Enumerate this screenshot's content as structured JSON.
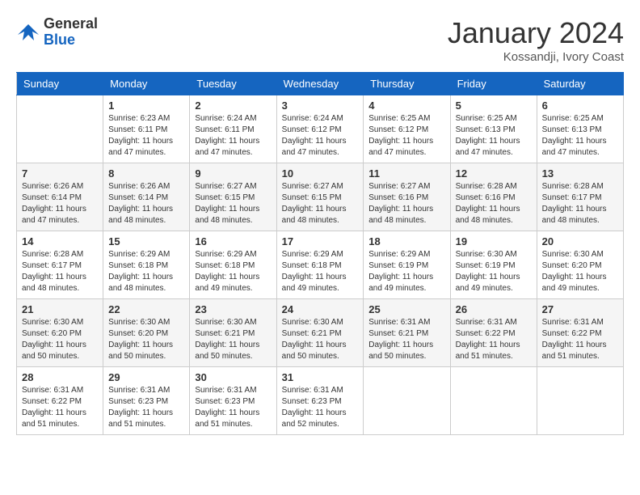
{
  "header": {
    "logo_general": "General",
    "logo_blue": "Blue",
    "title": "January 2024",
    "subtitle": "Kossandji, Ivory Coast"
  },
  "days_of_week": [
    "Sunday",
    "Monday",
    "Tuesday",
    "Wednesday",
    "Thursday",
    "Friday",
    "Saturday"
  ],
  "weeks": [
    [
      {
        "day": "",
        "info": ""
      },
      {
        "day": "1",
        "info": "Sunrise: 6:23 AM\nSunset: 6:11 PM\nDaylight: 11 hours\nand 47 minutes."
      },
      {
        "day": "2",
        "info": "Sunrise: 6:24 AM\nSunset: 6:11 PM\nDaylight: 11 hours\nand 47 minutes."
      },
      {
        "day": "3",
        "info": "Sunrise: 6:24 AM\nSunset: 6:12 PM\nDaylight: 11 hours\nand 47 minutes."
      },
      {
        "day": "4",
        "info": "Sunrise: 6:25 AM\nSunset: 6:12 PM\nDaylight: 11 hours\nand 47 minutes."
      },
      {
        "day": "5",
        "info": "Sunrise: 6:25 AM\nSunset: 6:13 PM\nDaylight: 11 hours\nand 47 minutes."
      },
      {
        "day": "6",
        "info": "Sunrise: 6:25 AM\nSunset: 6:13 PM\nDaylight: 11 hours\nand 47 minutes."
      }
    ],
    [
      {
        "day": "7",
        "info": "Sunrise: 6:26 AM\nSunset: 6:14 PM\nDaylight: 11 hours\nand 47 minutes."
      },
      {
        "day": "8",
        "info": "Sunrise: 6:26 AM\nSunset: 6:14 PM\nDaylight: 11 hours\nand 48 minutes."
      },
      {
        "day": "9",
        "info": "Sunrise: 6:27 AM\nSunset: 6:15 PM\nDaylight: 11 hours\nand 48 minutes."
      },
      {
        "day": "10",
        "info": "Sunrise: 6:27 AM\nSunset: 6:15 PM\nDaylight: 11 hours\nand 48 minutes."
      },
      {
        "day": "11",
        "info": "Sunrise: 6:27 AM\nSunset: 6:16 PM\nDaylight: 11 hours\nand 48 minutes."
      },
      {
        "day": "12",
        "info": "Sunrise: 6:28 AM\nSunset: 6:16 PM\nDaylight: 11 hours\nand 48 minutes."
      },
      {
        "day": "13",
        "info": "Sunrise: 6:28 AM\nSunset: 6:17 PM\nDaylight: 11 hours\nand 48 minutes."
      }
    ],
    [
      {
        "day": "14",
        "info": "Sunrise: 6:28 AM\nSunset: 6:17 PM\nDaylight: 11 hours\nand 48 minutes."
      },
      {
        "day": "15",
        "info": "Sunrise: 6:29 AM\nSunset: 6:18 PM\nDaylight: 11 hours\nand 48 minutes."
      },
      {
        "day": "16",
        "info": "Sunrise: 6:29 AM\nSunset: 6:18 PM\nDaylight: 11 hours\nand 49 minutes."
      },
      {
        "day": "17",
        "info": "Sunrise: 6:29 AM\nSunset: 6:18 PM\nDaylight: 11 hours\nand 49 minutes."
      },
      {
        "day": "18",
        "info": "Sunrise: 6:29 AM\nSunset: 6:19 PM\nDaylight: 11 hours\nand 49 minutes."
      },
      {
        "day": "19",
        "info": "Sunrise: 6:30 AM\nSunset: 6:19 PM\nDaylight: 11 hours\nand 49 minutes."
      },
      {
        "day": "20",
        "info": "Sunrise: 6:30 AM\nSunset: 6:20 PM\nDaylight: 11 hours\nand 49 minutes."
      }
    ],
    [
      {
        "day": "21",
        "info": "Sunrise: 6:30 AM\nSunset: 6:20 PM\nDaylight: 11 hours\nand 50 minutes."
      },
      {
        "day": "22",
        "info": "Sunrise: 6:30 AM\nSunset: 6:20 PM\nDaylight: 11 hours\nand 50 minutes."
      },
      {
        "day": "23",
        "info": "Sunrise: 6:30 AM\nSunset: 6:21 PM\nDaylight: 11 hours\nand 50 minutes."
      },
      {
        "day": "24",
        "info": "Sunrise: 6:30 AM\nSunset: 6:21 PM\nDaylight: 11 hours\nand 50 minutes."
      },
      {
        "day": "25",
        "info": "Sunrise: 6:31 AM\nSunset: 6:21 PM\nDaylight: 11 hours\nand 50 minutes."
      },
      {
        "day": "26",
        "info": "Sunrise: 6:31 AM\nSunset: 6:22 PM\nDaylight: 11 hours\nand 51 minutes."
      },
      {
        "day": "27",
        "info": "Sunrise: 6:31 AM\nSunset: 6:22 PM\nDaylight: 11 hours\nand 51 minutes."
      }
    ],
    [
      {
        "day": "28",
        "info": "Sunrise: 6:31 AM\nSunset: 6:22 PM\nDaylight: 11 hours\nand 51 minutes."
      },
      {
        "day": "29",
        "info": "Sunrise: 6:31 AM\nSunset: 6:23 PM\nDaylight: 11 hours\nand 51 minutes."
      },
      {
        "day": "30",
        "info": "Sunrise: 6:31 AM\nSunset: 6:23 PM\nDaylight: 11 hours\nand 51 minutes."
      },
      {
        "day": "31",
        "info": "Sunrise: 6:31 AM\nSunset: 6:23 PM\nDaylight: 11 hours\nand 52 minutes."
      },
      {
        "day": "",
        "info": ""
      },
      {
        "day": "",
        "info": ""
      },
      {
        "day": "",
        "info": ""
      }
    ]
  ]
}
